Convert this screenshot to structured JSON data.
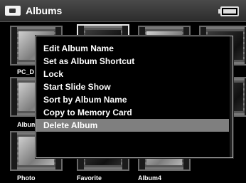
{
  "header": {
    "title": "Albums",
    "icon": "album-icon",
    "status_icon": "battery-icon"
  },
  "thumbnails": [
    {
      "label": "PC_D"
    },
    {
      "label": "Album"
    },
    {
      "label": "Photo"
    },
    {
      "label": "Favorite"
    },
    {
      "label": "Album4"
    }
  ],
  "menu": {
    "items": [
      {
        "label": "Edit Album Name"
      },
      {
        "label": "Set as Album Shortcut"
      },
      {
        "label": "Lock"
      },
      {
        "label": "Start Slide Show"
      },
      {
        "label": "Sort by Album Name"
      },
      {
        "label": "Copy to Memory Card"
      },
      {
        "label": "Delete Album"
      }
    ],
    "selected_index": 6,
    "highlight_color": "#7f7f7f"
  }
}
